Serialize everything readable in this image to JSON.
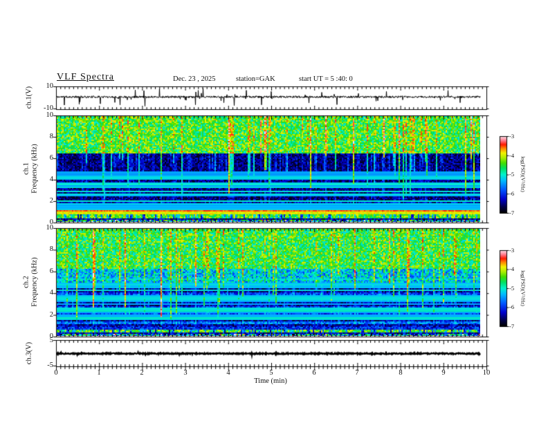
{
  "header": {
    "title": "VLF  Spectra",
    "date": "Dec. 23 , 2025",
    "station": "station=GAK",
    "start": "start UT =  5 :40: 0"
  },
  "panels": {
    "wave1": {
      "label": "ch.1(V)",
      "ymax": "10",
      "ymin": "-10"
    },
    "spec1": {
      "channel": "ch.1",
      "ylabel": "Frequency  (kHz)",
      "yticks": [
        "10",
        "8",
        "6",
        "4",
        "2",
        "0"
      ]
    },
    "spec2": {
      "channel": "ch.2",
      "ylabel": "Frequency  (kHz)",
      "yticks": [
        "10",
        "8",
        "6",
        "4",
        "2",
        "0"
      ]
    },
    "wave3": {
      "label": "ch.3(V)",
      "ymax": "5",
      "ymin": "-5"
    }
  },
  "xaxis": {
    "label": "Time  (min)",
    "ticks": [
      "0",
      "1",
      "2",
      "3",
      "4",
      "5",
      "6",
      "7",
      "8",
      "9",
      "10"
    ]
  },
  "colorbar": {
    "label": "log(PSD)(V²/Hz)",
    "ticks": [
      "-3",
      "-4",
      "-5",
      "-6",
      "-7"
    ],
    "zmin": -7,
    "zmax": -3,
    "stops": [
      {
        "t": 0.0,
        "hex": "#000000"
      },
      {
        "t": 0.08,
        "hex": "#00004a"
      },
      {
        "t": 0.18,
        "hex": "#0000cc"
      },
      {
        "t": 0.3,
        "hex": "#0055ff"
      },
      {
        "t": 0.42,
        "hex": "#00bbff"
      },
      {
        "t": 0.5,
        "hex": "#00f2cc"
      },
      {
        "t": 0.58,
        "hex": "#00e060"
      },
      {
        "t": 0.65,
        "hex": "#44dd00"
      },
      {
        "t": 0.72,
        "hex": "#b0ee00"
      },
      {
        "t": 0.78,
        "hex": "#f2f200"
      },
      {
        "t": 0.84,
        "hex": "#ff8800"
      },
      {
        "t": 0.89,
        "hex": "#ff1a00"
      },
      {
        "t": 0.94,
        "hex": "#ff7788"
      },
      {
        "t": 1.0,
        "hex": "#ffe6ee"
      }
    ]
  },
  "chart_data": [
    {
      "type": "line",
      "name": "ch.1 waveform",
      "ylabel": "ch.1(V)",
      "x_range_min": [
        0,
        10
      ],
      "y_range": [
        -10,
        10
      ],
      "description": "broadband noise centered near +1 V with impulsive spikes reaching about ±9 V",
      "render": {
        "seed": 11,
        "baseline": 0.8,
        "noise": 0.9,
        "spike_prob": 0.045,
        "spike_min": 1.5,
        "spike_span": 6.5,
        "down_bias": 0.62,
        "thickness": 1
      }
    },
    {
      "type": "heatmap",
      "name": "ch.1 spectrogram",
      "x_range_min": [
        0,
        10
      ],
      "y_range_kHz": [
        0,
        10
      ],
      "z_range_logPSD": [
        -7,
        -3
      ],
      "description": "VLF spectrogram: bright green/yellow sferic streaks above ~6.5 kHz, dark blue 1-6.5 kHz with vertical streaks and cyan power-line harmonics, bright yellow/red band near 0.8-1.1 kHz, speckled band below 0.3 kHz",
      "render": {
        "seed": 23,
        "streaks": {
          "strong_prob": 0.045,
          "med_prob": 0.17,
          "weak_prob": 0.55,
          "depth_min": 2.2,
          "depth_max": 6.8
        },
        "hlines": {
          "count": 26,
          "fmin": 1.1,
          "fmax": 5.0,
          "strength": 0.9,
          "level": -5.7
        },
        "row_mod": 0,
        "regions": [
          {
            "f0": 6.5,
            "f1": 10.01,
            "base": -4.55,
            "noise": 0.6,
            "streak": 0.5
          },
          {
            "f0": 2.0,
            "f1": 6.5,
            "base": -6.55,
            "noise": 0.4,
            "streak": 1.2,
            "hlines": true
          },
          {
            "f0": 1.15,
            "f1": 2.0,
            "base": -6.3,
            "noise": 0.45,
            "streak": 1.0,
            "hlines": true
          },
          {
            "f0": 1.02,
            "f1": 1.15,
            "base": -3.55,
            "noise": 0.15
          },
          {
            "f0": 0.78,
            "f1": 1.02,
            "base": -3.95,
            "noise": 0.2
          },
          {
            "f0": 0.45,
            "f1": 0.78,
            "base": -4.35,
            "noise": 0.45,
            "stripes": true
          },
          {
            "f0": 0.26,
            "f1": 0.45,
            "base": -6.45,
            "noise": 0.45
          },
          {
            "f0": -0.01,
            "f1": 0.26,
            "base": -5.3,
            "noise": 1.2,
            "speckle": true
          }
        ]
      }
    },
    {
      "type": "heatmap",
      "name": "ch.2 spectrogram",
      "x_range_min": [
        0,
        10
      ],
      "y_range_kHz": [
        0,
        10
      ],
      "z_range_logPSD": [
        -7,
        -3
      ],
      "description": "VLF spectrogram: green/yellow streaks above ~6 kHz, blue-cyan horizontally striped region below 5 kHz with many cyan harmonic lines, bright yellow-green band near 0.4-0.6 kHz, speckled bottom rows",
      "render": {
        "seed": 41,
        "streaks": {
          "strong_prob": 0.05,
          "med_prob": 0.18,
          "weak_prob": 0.5,
          "depth_min": 1.5,
          "depth_max": 6.0
        },
        "hlines": {
          "count": 34,
          "fmin": 0.6,
          "fmax": 5.4,
          "strength": 1.0,
          "level": -5.6
        },
        "row_mod": 0.5,
        "regions": [
          {
            "f0": 6.3,
            "f1": 10.01,
            "base": -4.6,
            "noise": 0.6,
            "streak": 0.5
          },
          {
            "f0": 5.0,
            "f1": 6.3,
            "base": -5.3,
            "noise": 0.7,
            "streak": 0.9,
            "hlines": true
          },
          {
            "f0": 1.0,
            "f1": 5.0,
            "base": -6.1,
            "noise": 0.45,
            "streak": 1.2,
            "hlines": true,
            "rowmod": true
          },
          {
            "f0": 0.62,
            "f1": 1.0,
            "base": -5.8,
            "noise": 0.5,
            "rowmod": true
          },
          {
            "f0": 0.38,
            "f1": 0.62,
            "base": -4.4,
            "noise": 0.5,
            "stripes": true
          },
          {
            "f0": 0.2,
            "f1": 0.38,
            "base": -6.35,
            "noise": 0.45
          },
          {
            "f0": -0.01,
            "f1": 0.2,
            "base": -5.4,
            "noise": 1.2,
            "speckle": true
          }
        ]
      }
    },
    {
      "type": "line",
      "name": "ch.3 waveform",
      "ylabel": "ch.3(V)",
      "x_range_min": [
        0,
        10
      ],
      "y_range": [
        -5,
        5
      ],
      "description": "flat dense trace near 0 V for the full record",
      "render": {
        "seed": 77,
        "baseline": -0.15,
        "noise": 0.22,
        "spike_prob": 0.01,
        "spike_min": 0.2,
        "spike_span": 0.5,
        "down_bias": 0.5,
        "thickness": 2.2
      }
    }
  ]
}
